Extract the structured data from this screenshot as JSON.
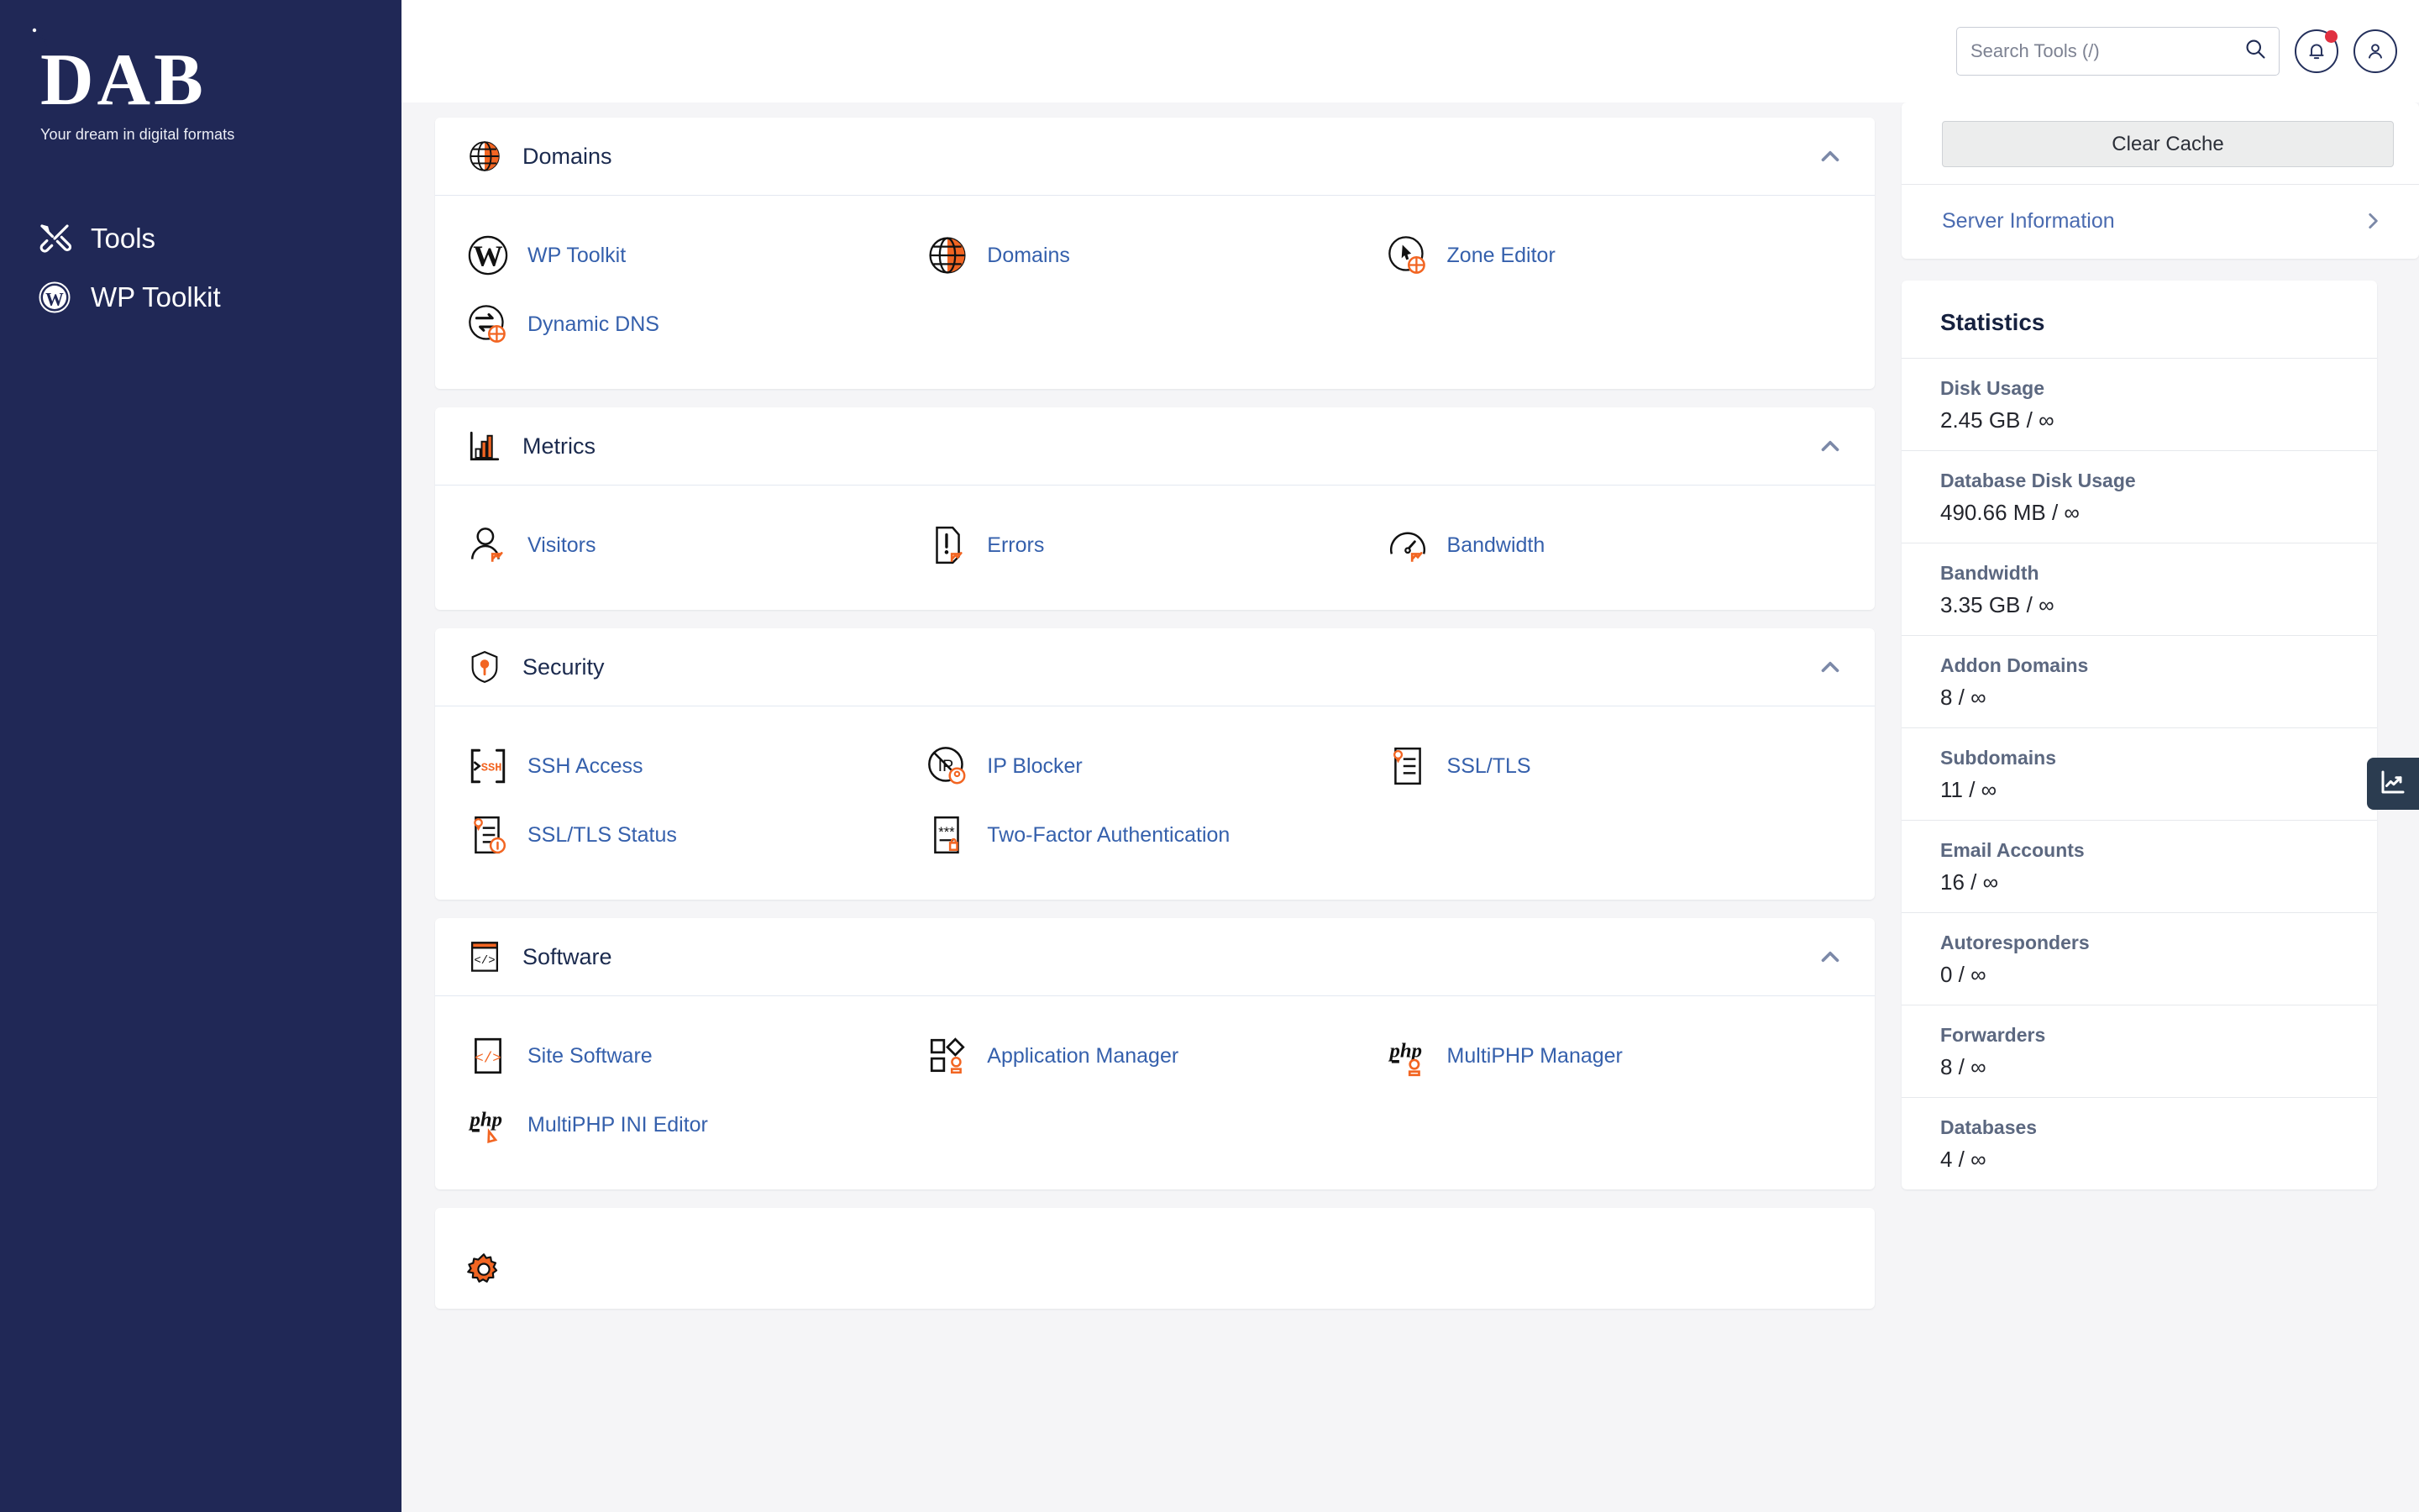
{
  "sidebar": {
    "logo_text": "DAB",
    "tagline": "Your dream in digital formats",
    "items": [
      {
        "label": "Tools",
        "icon": "tools-icon"
      },
      {
        "label": "WP Toolkit",
        "icon": "wordpress-icon"
      }
    ]
  },
  "topbar": {
    "search_placeholder": "Search Tools (/)",
    "search_value": "",
    "search_icon": "search-icon",
    "notifications_icon": "bell-icon",
    "account_icon": "user-icon",
    "has_notification": true
  },
  "sections": [
    {
      "title": "Domains",
      "icon": "globe-icon",
      "collapse_icon": "chevron-up-icon",
      "tools": [
        {
          "label": "WP Toolkit",
          "icon": "wordpress-icon"
        },
        {
          "label": "Domains",
          "icon": "globe-icon"
        },
        {
          "label": "Zone Editor",
          "icon": "zone-editor-icon"
        },
        {
          "label": "Dynamic DNS",
          "icon": "dynamic-dns-icon"
        }
      ]
    },
    {
      "title": "Metrics",
      "icon": "bar-chart-icon",
      "collapse_icon": "chevron-up-icon",
      "tools": [
        {
          "label": "Visitors",
          "icon": "visitors-icon"
        },
        {
          "label": "Errors",
          "icon": "errors-icon"
        },
        {
          "label": "Bandwidth",
          "icon": "gauge-icon"
        }
      ]
    },
    {
      "title": "Security",
      "icon": "shield-icon",
      "collapse_icon": "chevron-up-icon",
      "tools": [
        {
          "label": "SSH Access",
          "icon": "ssh-icon"
        },
        {
          "label": "IP Blocker",
          "icon": "ip-blocker-icon"
        },
        {
          "label": "SSL/TLS",
          "icon": "certificate-icon"
        },
        {
          "label": "SSL/TLS Status",
          "icon": "certificate-status-icon"
        },
        {
          "label": "Two-Factor Authentication",
          "icon": "two-factor-icon"
        }
      ]
    },
    {
      "title": "Software",
      "icon": "code-window-icon",
      "collapse_icon": "chevron-up-icon",
      "tools": [
        {
          "label": "Site Software",
          "icon": "code-page-icon"
        },
        {
          "label": "Application Manager",
          "icon": "application-manager-icon"
        },
        {
          "label": "MultiPHP Manager",
          "icon": "php-icon"
        },
        {
          "label": "MultiPHP INI Editor",
          "icon": "php-edit-icon"
        }
      ]
    }
  ],
  "partial_section": {
    "icon": "gear-icon"
  },
  "aside": {
    "clear_cache_label": "Clear Cache",
    "server_information_label": "Server Information",
    "server_information_chevron": "chevron-right-icon",
    "statistics_title": "Statistics",
    "statistics": [
      {
        "label": "Disk Usage",
        "value": "2.45 GB / ∞"
      },
      {
        "label": "Database Disk Usage",
        "value": "490.66 MB / ∞"
      },
      {
        "label": "Bandwidth",
        "value": "3.35 GB / ∞"
      },
      {
        "label": "Addon Domains",
        "value": "8 / ∞"
      },
      {
        "label": "Subdomains",
        "value": "11 / ∞"
      },
      {
        "label": "Email Accounts",
        "value": "16 / ∞"
      },
      {
        "label": "Autoresponders",
        "value": "0 / ∞"
      },
      {
        "label": "Forwarders",
        "value": "8 / ∞"
      },
      {
        "label": "Databases",
        "value": "4 / ∞"
      }
    ]
  },
  "float_tab": {
    "icon": "line-chart-icon"
  },
  "colors": {
    "sidebar_bg": "#202856",
    "accent_orange": "#f26522",
    "link_blue": "#3560ac",
    "title_navy": "#1b2a4e",
    "page_bg": "#f5f5f7",
    "notification_red": "#e03040"
  }
}
